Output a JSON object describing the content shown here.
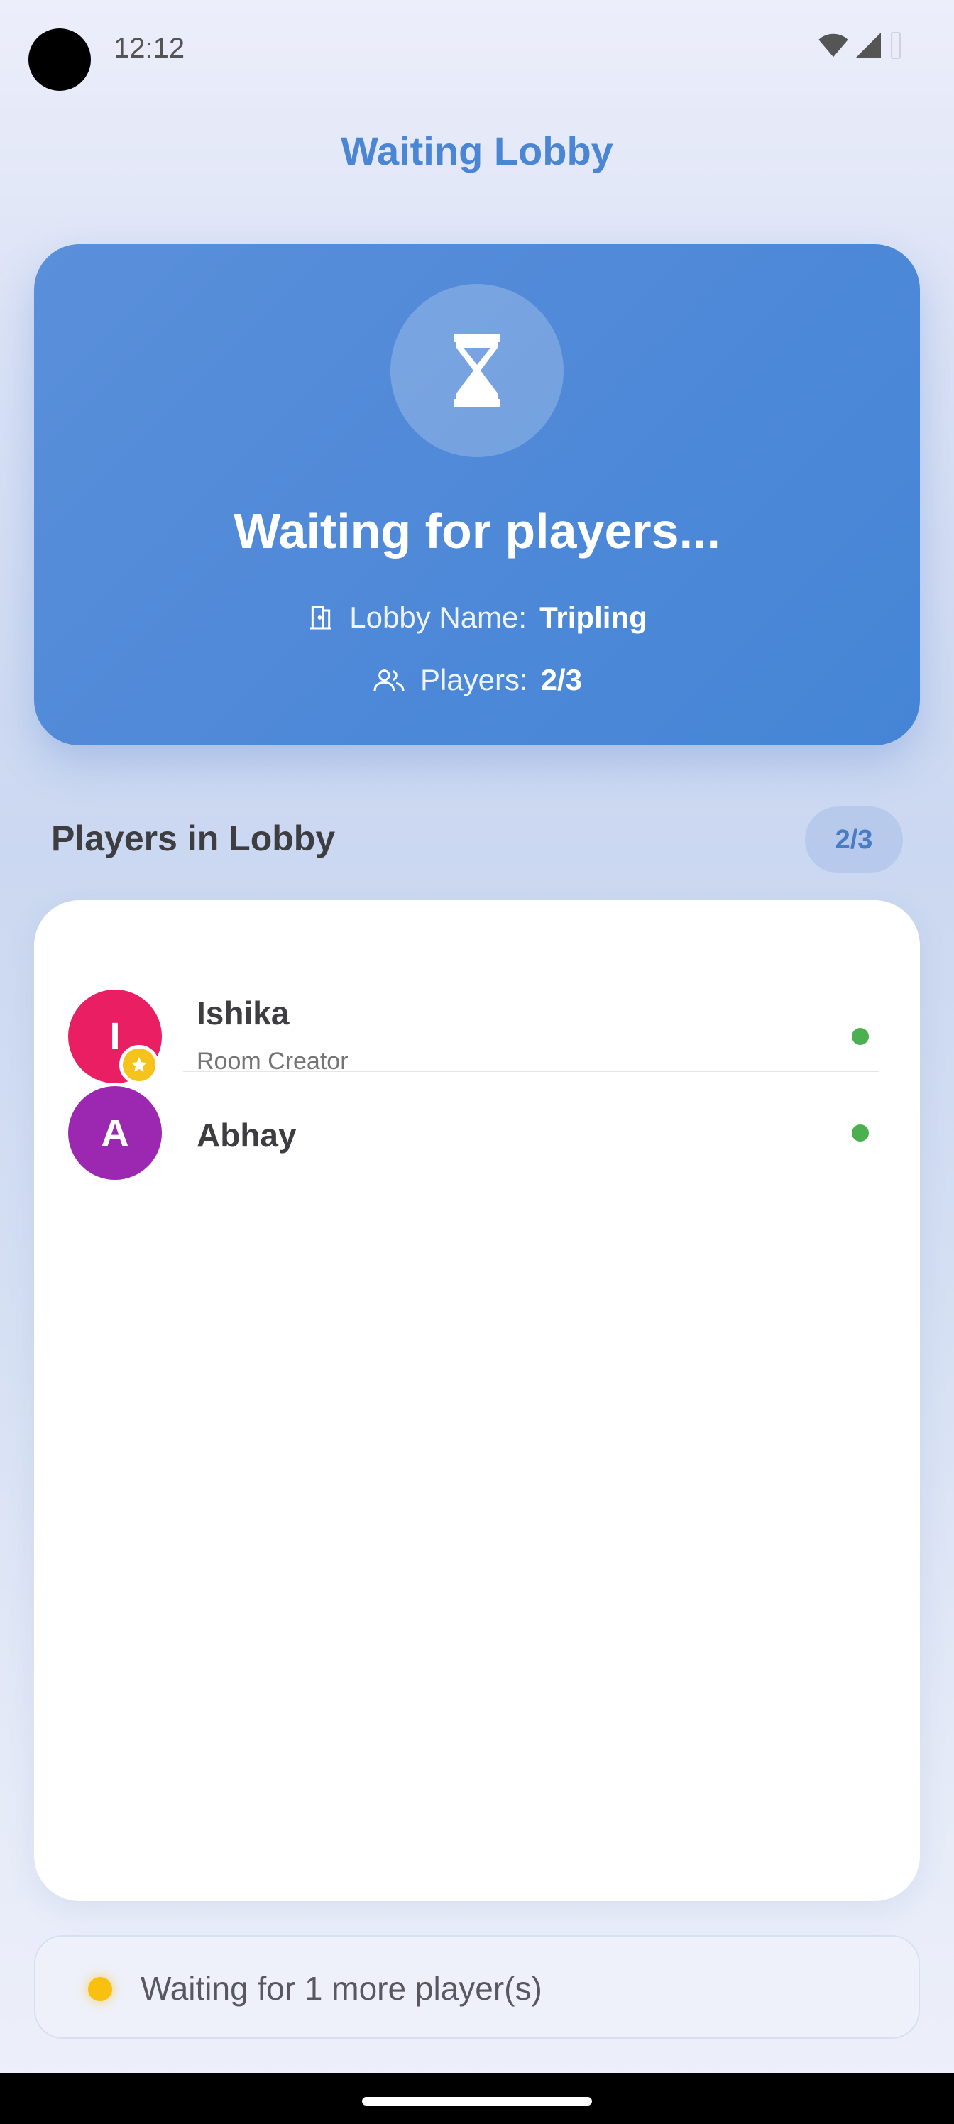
{
  "status_bar": {
    "time": "12:12"
  },
  "header": {
    "title": "Waiting Lobby"
  },
  "hero": {
    "heading": "Waiting for players...",
    "lobby_label": "Lobby Name:",
    "lobby_value": "Tripling",
    "players_label": "Players:",
    "players_value": "2/3"
  },
  "players_section": {
    "title": "Players in Lobby",
    "count": "2/3",
    "players": [
      {
        "initial": "I",
        "name": "Ishika",
        "role": "Room Creator",
        "avatar_color": "#e91e63",
        "is_creator": true,
        "online": true
      },
      {
        "initial": "A",
        "name": "Abhay",
        "role": "",
        "avatar_color": "#9c27b0",
        "is_creator": false,
        "online": true
      }
    ]
  },
  "footer_status": {
    "text": "Waiting for 1 more player(s)"
  },
  "colors": {
    "accent": "#4a86d4",
    "online": "#4caf50",
    "waiting": "#f9c00f",
    "creator_badge": "#f6c21c"
  },
  "icons": {
    "hero": "hourglass-icon",
    "lobby": "door-icon",
    "players": "people-icon",
    "creator": "star-icon"
  }
}
